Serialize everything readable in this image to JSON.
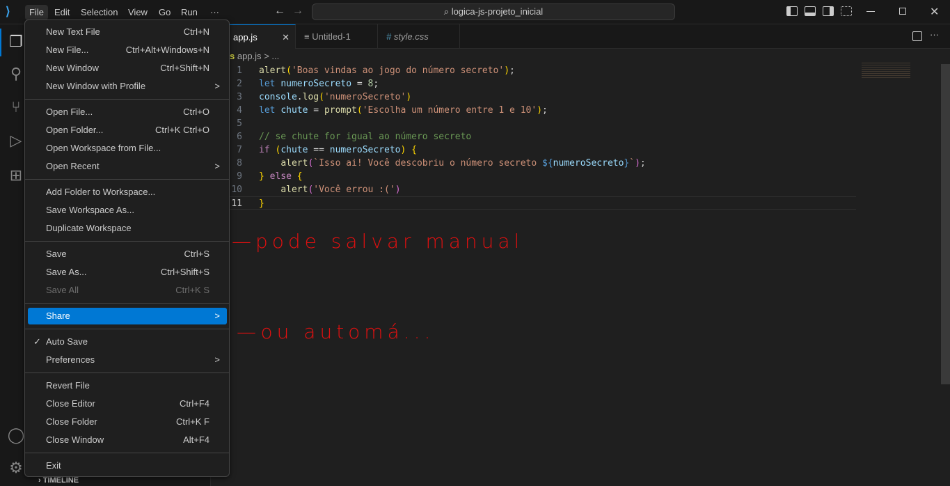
{
  "titlebar": {
    "menus": [
      "File",
      "Edit",
      "Selection",
      "View",
      "Go",
      "Run",
      "···"
    ],
    "search": "logica-js-projeto_inicial"
  },
  "tabs": [
    {
      "label": "app.js",
      "icon": "JS",
      "close": "✕"
    },
    {
      "label": "Untitled-1",
      "icon": "≡"
    },
    {
      "label": "style.css",
      "icon": "#"
    }
  ],
  "breadcrumb": {
    "file": "app.js",
    "sep": ">",
    "rest": "..."
  },
  "code": [
    "alert('Boas vindas ao jogo do número secreto');",
    "let numeroSecreto = 8;",
    "console.log('numeroSecreto')",
    "let chute = prompt('Escolha um número entre 1 e 10');",
    "",
    "// se chute for igual ao número secreto",
    "if (chute == numeroSecreto) {",
    "    alert(`Isso ai! Você descobriu o número secreto ${numeroSecreto}`);",
    "} else {",
    "    alert('Você errou :(')",
    "}"
  ],
  "line_numbers": [
    "1",
    "2",
    "3",
    "4",
    "5",
    "6",
    "7",
    "8",
    "9",
    "10",
    "11"
  ],
  "annotations": [
    "—pode salvar manual",
    "—ou automá..."
  ],
  "sidebar": {
    "timeline": "TIMELINE"
  },
  "file_menu": {
    "items": [
      {
        "label": "New Text File",
        "shortcut": "Ctrl+N"
      },
      {
        "label": "New File...",
        "shortcut": "Ctrl+Alt+Windows+N"
      },
      {
        "label": "New Window",
        "shortcut": "Ctrl+Shift+N"
      },
      {
        "label": "New Window with Profile",
        "submenu": ">"
      },
      {
        "label": "Open File...",
        "shortcut": "Ctrl+O"
      },
      {
        "label": "Open Folder...",
        "shortcut": "Ctrl+K Ctrl+O"
      },
      {
        "label": "Open Workspace from File..."
      },
      {
        "label": "Open Recent",
        "submenu": ">"
      },
      {
        "label": "Add Folder to Workspace..."
      },
      {
        "label": "Save Workspace As..."
      },
      {
        "label": "Duplicate Workspace"
      },
      {
        "label": "Save",
        "shortcut": "Ctrl+S"
      },
      {
        "label": "Save As...",
        "shortcut": "Ctrl+Shift+S"
      },
      {
        "label": "Save All",
        "shortcut": "Ctrl+K S",
        "disabled": true
      },
      {
        "label": "Share",
        "submenu": ">",
        "highlighted": true
      },
      {
        "label": "Auto Save",
        "checked": "✓"
      },
      {
        "label": "Preferences",
        "submenu": ">"
      },
      {
        "label": "Revert File"
      },
      {
        "label": "Close Editor",
        "shortcut": "Ctrl+F4"
      },
      {
        "label": "Close Folder",
        "shortcut": "Ctrl+K F"
      },
      {
        "label": "Close Window",
        "shortcut": "Alt+F4"
      },
      {
        "label": "Exit"
      }
    ]
  },
  "colors": {
    "accent": "#0078d4",
    "annotation": "#e01010"
  }
}
